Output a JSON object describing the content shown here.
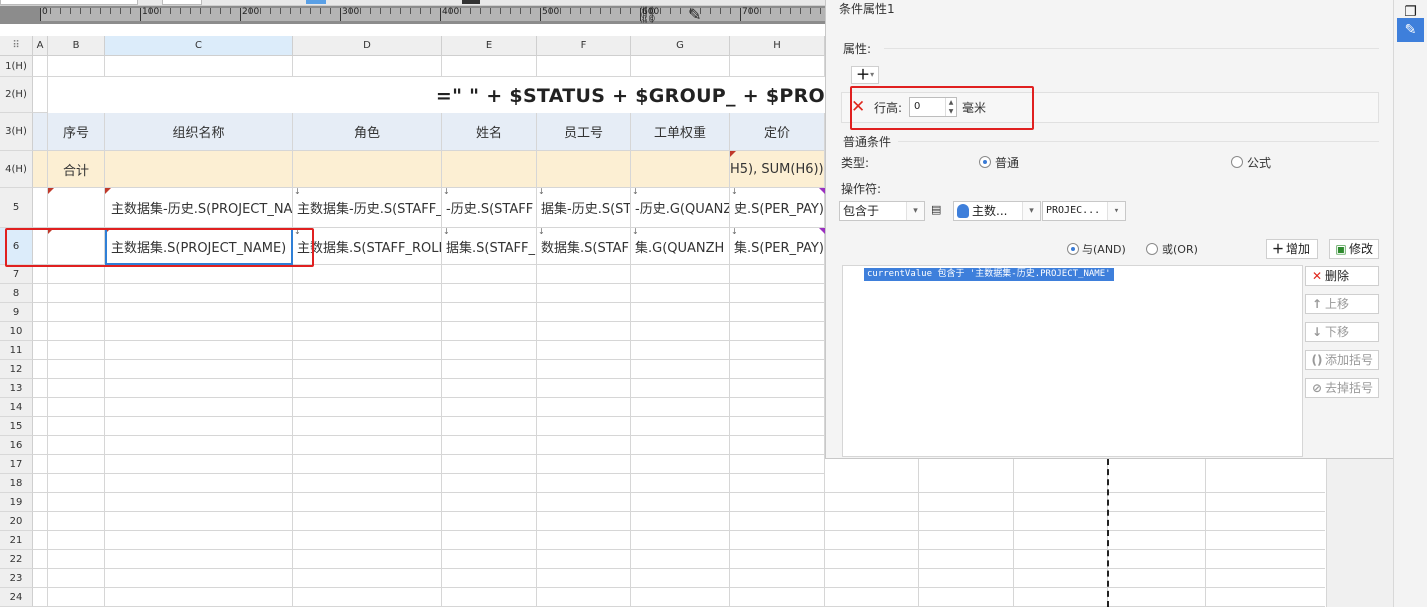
{
  "ruler": {
    "labels": [
      "0",
      "100",
      "200",
      "300",
      "400",
      "500",
      "600",
      "700"
    ]
  },
  "sheet": {
    "corner": "A",
    "columns": [
      {
        "key": "A",
        "label": "A"
      },
      {
        "key": "B",
        "label": "B"
      },
      {
        "key": "C",
        "label": "C"
      },
      {
        "key": "D",
        "label": "D"
      },
      {
        "key": "E",
        "label": "E"
      },
      {
        "key": "F",
        "label": "F"
      },
      {
        "key": "G",
        "label": "G"
      },
      {
        "key": "H",
        "label": "H"
      }
    ],
    "rows": [
      "1(H)",
      "2(H)",
      "3(H)",
      "4(H)",
      "5",
      "6",
      "7",
      "8",
      "9",
      "10",
      "11",
      "12",
      "13",
      "14",
      "15",
      "16",
      "17",
      "18",
      "19",
      "20",
      "21",
      "22",
      "23",
      "24"
    ],
    "title_formula": "=\" \" + $STATUS + $GROUP_ + $PRO",
    "header_row": [
      "序号",
      "组织名称",
      "角色",
      "姓名",
      "员工号",
      "工单权重",
      "定价"
    ],
    "total_row": {
      "label": "合计",
      "h_formula": "H5), SUM(H6))"
    },
    "row5": [
      "主数据集-历史.S(PROJECT_NA",
      "主数据集-历史.S(STAFF_",
      "-历史.S(STAFF",
      "据集-历史.S(STA",
      "-历史.G(QUANZ",
      "史.S(PER_PAY)"
    ],
    "row6": [
      "主数据集.S(PROJECT_NAME)",
      "主数据集.S(STAFF_ROLE",
      "据集.S(STAFF_N",
      "数据集.S(STAFF_",
      "集.G(QUANZH",
      "集.S(PER_PAY)"
    ]
  },
  "dialog": {
    "title": "条件属性1",
    "property_label": "属性:",
    "row_height_label": "行高:",
    "row_height_value": "0",
    "unit": "毫米",
    "normal_condition_label": "普通条件",
    "type_label": "类型:",
    "type_normal": "普通",
    "type_formula": "公式",
    "operator_label": "操作符:",
    "operator_value": "包含于",
    "dataset_value": "主数...",
    "field_value": "PROJEC...",
    "and_label": "与(AND)",
    "or_label": "或(OR)",
    "add_button": "增加",
    "modify_button": "修改",
    "delete_button": "删除",
    "up_button": "上移",
    "down_button": "下移",
    "add_bracket_button": "添加括号",
    "remove_bracket_button": "去掉括号",
    "condition_item": "currentValue 包含于 '主数据集-历史.PROJECT_NAME'"
  },
  "colors": {
    "selection": "#2f7fd6",
    "highlight": "#e02020",
    "header_fill": "#e6edf6",
    "total_fill": "#fcefd3"
  }
}
